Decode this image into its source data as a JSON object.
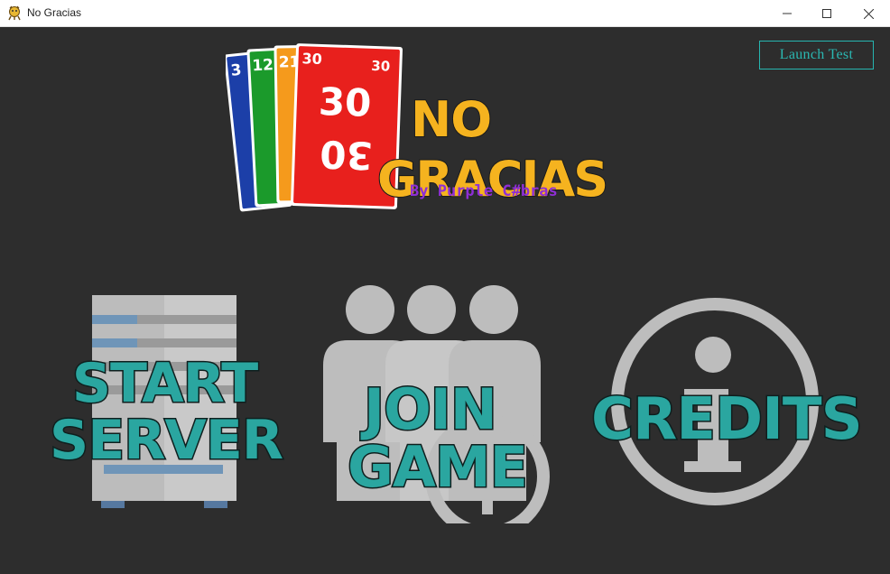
{
  "window": {
    "title": "No Gracias",
    "controls": {
      "minimize": "minimize-icon",
      "maximize": "maximize-icon",
      "close": "close-icon"
    }
  },
  "launch_test_label": "Launch Test",
  "logo": {
    "title_line1": "NO",
    "title_line2": "GRACIAS",
    "byline": "By Purple C#bras",
    "cards": [
      {
        "value": "3",
        "color": "#1c3fa8"
      },
      {
        "value": "12",
        "color": "#1b9a2b"
      },
      {
        "value": "21",
        "color": "#f59a1c"
      },
      {
        "value": "30",
        "color": "#e8201d"
      }
    ],
    "title_color": "#f5b31f"
  },
  "menu": {
    "start_server": {
      "line1": "START",
      "line2": "SERVER",
      "icon": "server-icon"
    },
    "join_game": {
      "line1": "JOIN",
      "line2": "GAME",
      "icon": "group-icon"
    },
    "credits": {
      "label": "CREDITS",
      "icon": "info-icon"
    }
  },
  "colors": {
    "background": "#2d2d2d",
    "accent": "#2ab8b2",
    "label_fill": "#2aa6a0",
    "icon_gray": "#bdbdbd"
  }
}
